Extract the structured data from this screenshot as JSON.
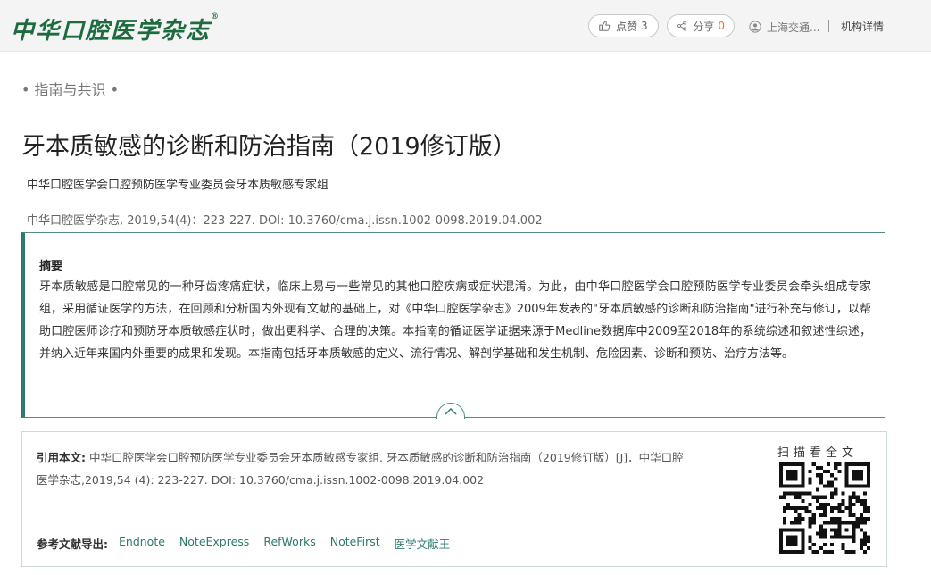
{
  "header": {
    "logo_text": "中华口腔医学杂志",
    "logo_mark": "®",
    "like_label": "点赞",
    "like_count": "3",
    "share_label": "分享",
    "share_count": "0",
    "user_name": "上海交通...",
    "org_link": "机构详情"
  },
  "article": {
    "section": "指南与共识",
    "title": "牙本质敏感的诊断和防治指南（2019修订版）",
    "authors": "中华口腔医学会口腔预防医学专业委员会牙本质敏感专家组",
    "citation_line": "中华口腔医学杂志, 2019,54(4)：223-227. DOI: 10.3760/cma.j.issn.1002-0098.2019.04.002"
  },
  "abstract": {
    "heading": "摘要",
    "text": "牙本质敏感是口腔常见的一种牙齿疼痛症状，临床上易与一些常见的其他口腔疾病或症状混淆。为此，由中华口腔医学会口腔预防医学专业委员会牵头组成专家组，采用循证医学的方法，在回顾和分析国内外现有文献的基础上，对《中华口腔医学杂志》2009年发表的\"牙本质敏感的诊断和防治指南\"进行补充与修订，以帮助口腔医师诊疗和预防牙本质敏感症状时，做出更科学、合理的决策。本指南的循证医学证据来源于Medline数据库中2009至2018年的系统综述和叙述性综述，并纳入近年来国内外重要的成果和发现。本指南包括牙本质敏感的定义、流行情况、解剖学基础和发生机制、危险因素、诊断和预防、治疗方法等。"
  },
  "cite": {
    "label": "引用本文:",
    "text": " 中华口腔医学会口腔预防医学专业委员会牙本质敏感专家组. 牙本质敏感的诊断和防治指南（2019修订版）[J]．中华口腔医学杂志,2019,54 (4): 223-227. DOI: 10.3760/cma.j.issn.1002-0098.2019.04.002",
    "export_label": "参考文献导出:",
    "export_links": [
      "Endnote",
      "NoteExpress",
      "RefWorks",
      "NoteFirst",
      "医学文献王"
    ],
    "qr_label": "扫描看全文"
  },
  "colors": {
    "brand_green": "#1d6b3f",
    "accent_teal": "#2e7a6f",
    "share_count": "#e8772e"
  }
}
